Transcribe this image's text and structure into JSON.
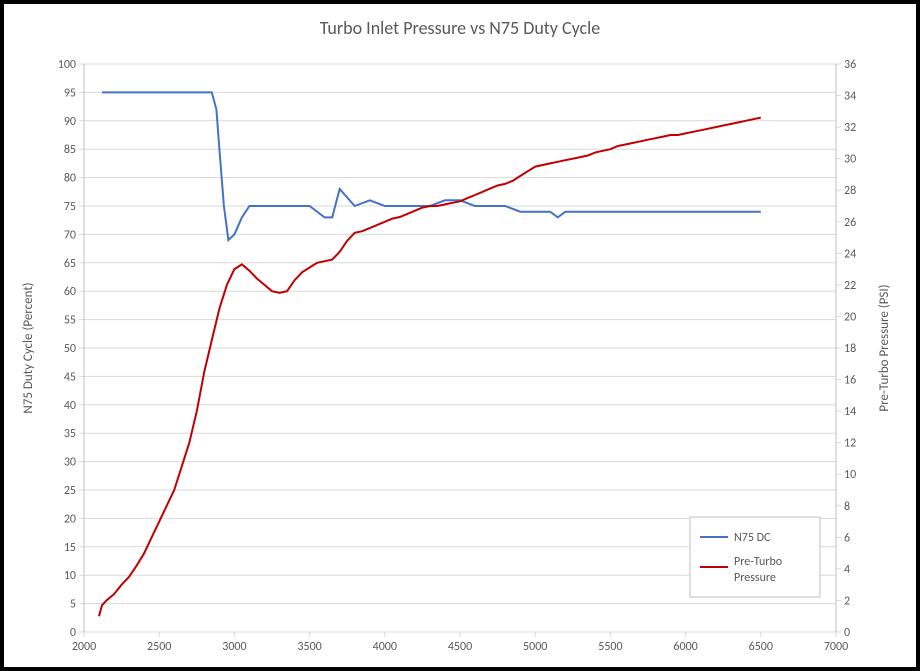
{
  "chart_data": {
    "type": "line",
    "title": "Turbo Inlet Pressure vs N75 Duty Cycle",
    "xlabel": "",
    "ylabel_left": "N75 Duty Cycle (Percent)",
    "ylabel_right": "Pre-Turbo Pressure (PSI)",
    "xlim": [
      2000,
      7000
    ],
    "ylim_left": [
      0,
      100
    ],
    "ylim_right": [
      0,
      36
    ],
    "x_ticks": [
      2000,
      2500,
      3000,
      3500,
      4000,
      4500,
      5000,
      5500,
      6000,
      6500,
      7000
    ],
    "y_ticks_left": [
      0,
      5,
      10,
      15,
      20,
      25,
      30,
      35,
      40,
      45,
      50,
      55,
      60,
      65,
      70,
      75,
      80,
      85,
      90,
      95,
      100
    ],
    "y_ticks_right": [
      0,
      2,
      4,
      6,
      8,
      10,
      12,
      14,
      16,
      18,
      20,
      22,
      24,
      26,
      28,
      30,
      32,
      34,
      36
    ],
    "series": [
      {
        "name": "N75 DC",
        "axis": "left",
        "color": "#4472c4",
        "x": [
          2120,
          2200,
          2300,
          2400,
          2500,
          2600,
          2700,
          2800,
          2850,
          2880,
          2900,
          2930,
          2960,
          3000,
          3050,
          3100,
          3150,
          3200,
          3250,
          3300,
          3400,
          3500,
          3600,
          3650,
          3680,
          3700,
          3800,
          3900,
          4000,
          4100,
          4200,
          4300,
          4400,
          4500,
          4600,
          4700,
          4800,
          4900,
          5000,
          5100,
          5150,
          5200,
          5300,
          5400,
          5500,
          5600,
          5700,
          5800,
          5900,
          6000,
          6100,
          6200,
          6300,
          6400,
          6500
        ],
        "y": [
          95,
          95,
          95,
          95,
          95,
          95,
          95,
          95,
          95,
          92,
          85,
          75,
          69,
          70,
          73,
          75,
          75,
          75,
          75,
          75,
          75,
          75,
          73,
          73,
          76,
          78,
          75,
          76,
          75,
          75,
          75,
          75,
          76,
          76,
          75,
          75,
          75,
          74,
          74,
          74,
          73,
          74,
          74,
          74,
          74,
          74,
          74,
          74,
          74,
          74,
          74,
          74,
          74,
          74,
          74
        ]
      },
      {
        "name": "Pre-Turbo Pressure",
        "axis": "right",
        "color": "#c00000",
        "x": [
          2100,
          2120,
          2150,
          2200,
          2250,
          2300,
          2350,
          2400,
          2450,
          2500,
          2550,
          2600,
          2650,
          2700,
          2750,
          2800,
          2850,
          2900,
          2950,
          3000,
          3050,
          3100,
          3150,
          3200,
          3250,
          3300,
          3350,
          3400,
          3450,
          3500,
          3550,
          3600,
          3650,
          3700,
          3750,
          3800,
          3850,
          3900,
          3950,
          4000,
          4050,
          4100,
          4150,
          4200,
          4250,
          4300,
          4350,
          4400,
          4450,
          4500,
          4550,
          4600,
          4650,
          4700,
          4750,
          4800,
          4850,
          4900,
          4950,
          5000,
          5050,
          5100,
          5150,
          5200,
          5250,
          5300,
          5350,
          5400,
          5450,
          5500,
          5550,
          5600,
          5650,
          5700,
          5750,
          5800,
          5850,
          5900,
          5950,
          6000,
          6050,
          6100,
          6150,
          6200,
          6250,
          6300,
          6350,
          6400,
          6450,
          6500
        ],
        "y": [
          1.0,
          1.7,
          2.0,
          2.4,
          3.0,
          3.5,
          4.2,
          5.0,
          6.0,
          7.0,
          8.0,
          9.0,
          10.5,
          12.0,
          14.0,
          16.5,
          18.5,
          20.5,
          22.0,
          23.0,
          23.3,
          22.9,
          22.4,
          22.0,
          21.6,
          21.5,
          21.6,
          22.3,
          22.8,
          23.1,
          23.4,
          23.5,
          23.6,
          24.1,
          24.8,
          25.3,
          25.4,
          25.6,
          25.8,
          26.0,
          26.2,
          26.3,
          26.5,
          26.7,
          26.9,
          27.0,
          27.0,
          27.1,
          27.2,
          27.3,
          27.5,
          27.7,
          27.9,
          28.1,
          28.3,
          28.4,
          28.6,
          28.9,
          29.2,
          29.5,
          29.6,
          29.7,
          29.8,
          29.9,
          30.0,
          30.1,
          30.2,
          30.4,
          30.5,
          30.6,
          30.8,
          30.9,
          31.0,
          31.1,
          31.2,
          31.3,
          31.4,
          31.5,
          31.5,
          31.6,
          31.7,
          31.8,
          31.9,
          32.0,
          32.1,
          32.2,
          32.3,
          32.4,
          32.5,
          32.6
        ]
      }
    ],
    "legend": {
      "entries": [
        "N75 DC",
        "Pre-Turbo Pressure"
      ],
      "position": "bottom-right"
    }
  }
}
